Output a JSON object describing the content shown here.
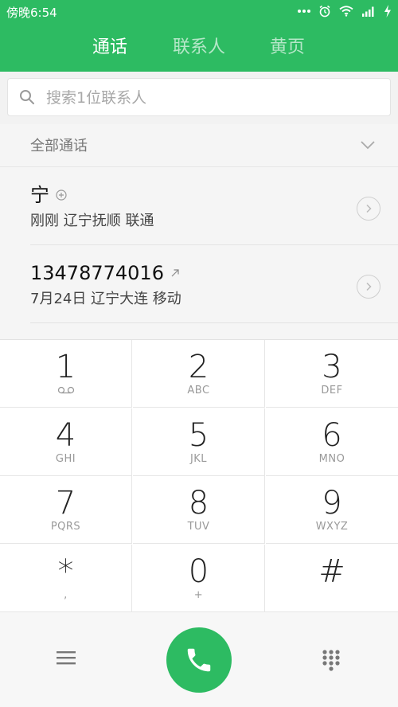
{
  "status_bar": {
    "time": "傍晚6:54",
    "icons": [
      "more-dots-icon",
      "alarm-icon",
      "wifi-icon",
      "signal-icon",
      "charging-icon"
    ]
  },
  "tabs": [
    {
      "label": "通话",
      "active": true
    },
    {
      "label": "联系人",
      "active": false
    },
    {
      "label": "黄页",
      "active": false
    }
  ],
  "search": {
    "placeholder": "搜索1位联系人"
  },
  "filter": {
    "label": "全部通话"
  },
  "calls": [
    {
      "name": "宁",
      "name_icon": "add-contact-icon",
      "detail": "刚刚 辽宁抚顺 联通"
    },
    {
      "name": "13478774016",
      "name_icon": "outgoing-call-icon",
      "detail": "7月24日 辽宁大连 移动"
    }
  ],
  "keypad": [
    {
      "digit": "1",
      "letters": "",
      "sub_icon": "voicemail-icon"
    },
    {
      "digit": "2",
      "letters": "ABC"
    },
    {
      "digit": "3",
      "letters": "DEF"
    },
    {
      "digit": "4",
      "letters": "GHI"
    },
    {
      "digit": "5",
      "letters": "JKL"
    },
    {
      "digit": "6",
      "letters": "MNO"
    },
    {
      "digit": "7",
      "letters": "PQRS"
    },
    {
      "digit": "8",
      "letters": "TUV"
    },
    {
      "digit": "9",
      "letters": "WXYZ"
    },
    {
      "digit": "*",
      "letters": ","
    },
    {
      "digit": "0",
      "letters": "+"
    },
    {
      "digit": "#",
      "letters": ""
    }
  ],
  "colors": {
    "accent": "#2dbb62",
    "background": "#f5f5f5"
  }
}
